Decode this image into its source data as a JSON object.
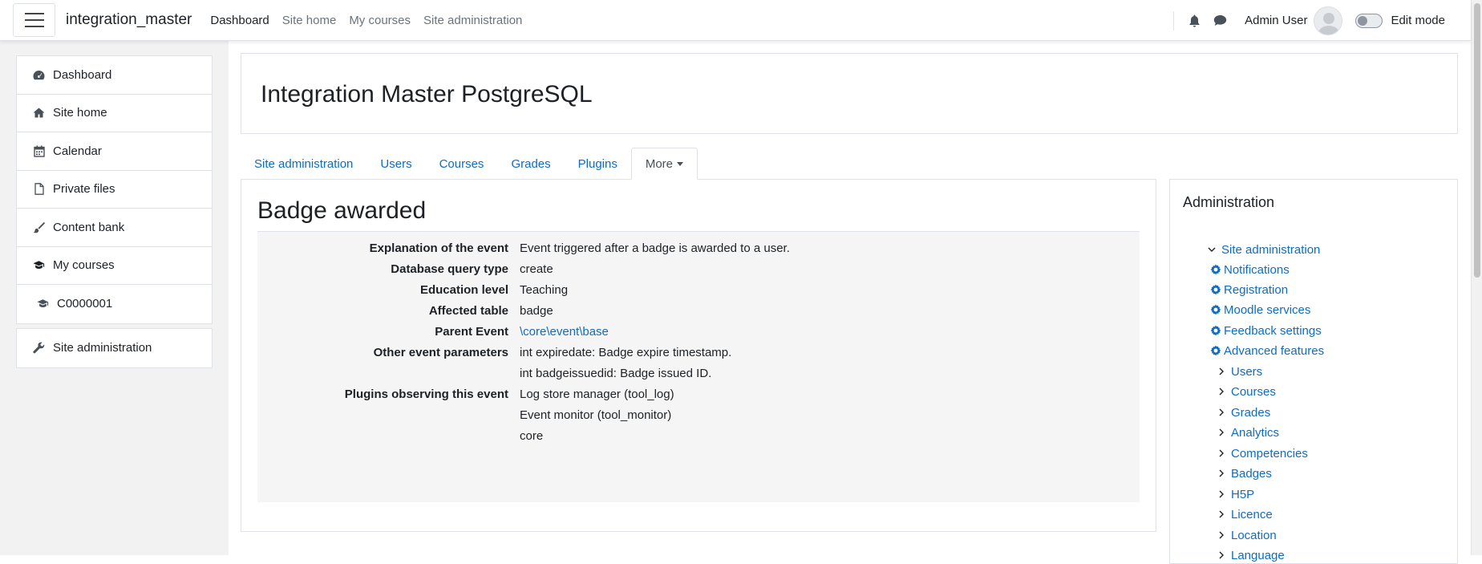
{
  "navbar": {
    "brand": "integration_master",
    "links": [
      {
        "label": "Dashboard",
        "active": true
      },
      {
        "label": "Site home",
        "active": false
      },
      {
        "label": "My courses",
        "active": false
      },
      {
        "label": "Site administration",
        "active": false
      }
    ],
    "user_name": "Admin User",
    "edit_mode_label": "Edit mode"
  },
  "drawer": {
    "items": [
      {
        "label": "Dashboard",
        "icon": "dashboard-icon"
      },
      {
        "label": "Site home",
        "icon": "home-icon"
      },
      {
        "label": "Calendar",
        "icon": "calendar-icon"
      },
      {
        "label": "Private files",
        "icon": "file-icon"
      },
      {
        "label": "Content bank",
        "icon": "brush-icon"
      },
      {
        "label": "My courses",
        "icon": "graduation-cap-icon"
      },
      {
        "label": "C0000001",
        "icon": "graduation-cap-icon"
      }
    ],
    "admin_item": {
      "label": "Site administration",
      "icon": "wrench-icon"
    }
  },
  "header": {
    "title": "Integration Master PostgreSQL"
  },
  "tabs": [
    {
      "label": "Site administration"
    },
    {
      "label": "Users"
    },
    {
      "label": "Courses"
    },
    {
      "label": "Grades"
    },
    {
      "label": "Plugins"
    },
    {
      "label": "More"
    }
  ],
  "main": {
    "title": "Badge awarded",
    "rows": {
      "explanation": {
        "label": "Explanation of the event",
        "value": "Event triggered after a badge is awarded to a user."
      },
      "crud": {
        "label": "Database query type",
        "value": "create"
      },
      "edulevel": {
        "label": "Education level",
        "value": "Teaching"
      },
      "table": {
        "label": "Affected table",
        "value": "badge"
      },
      "parent": {
        "label": "Parent Event",
        "value": "\\core\\event\\base"
      },
      "other": {
        "label": "Other event parameters",
        "values": [
          "int expiredate: Badge expire timestamp.",
          "int badgeissuedid: Badge issued ID."
        ]
      },
      "observers": {
        "label": "Plugins observing this event",
        "values": [
          "Log store manager (tool_log)",
          "Event monitor (tool_monitor)",
          "core"
        ]
      }
    }
  },
  "admin_block": {
    "title": "Administration",
    "root": "Site administration",
    "settings": [
      "Notifications",
      "Registration",
      "Moodle services",
      "Feedback settings",
      "Advanced features"
    ],
    "categories": [
      "Users",
      "Courses",
      "Grades",
      "Analytics",
      "Competencies",
      "Badges",
      "H5P",
      "Licence",
      "Location",
      "Language"
    ]
  },
  "colors": {
    "link": "#0f6cbf",
    "text": "#1d2125",
    "muted": "#6a737b",
    "drawer_bg": "#f2f2f2"
  }
}
